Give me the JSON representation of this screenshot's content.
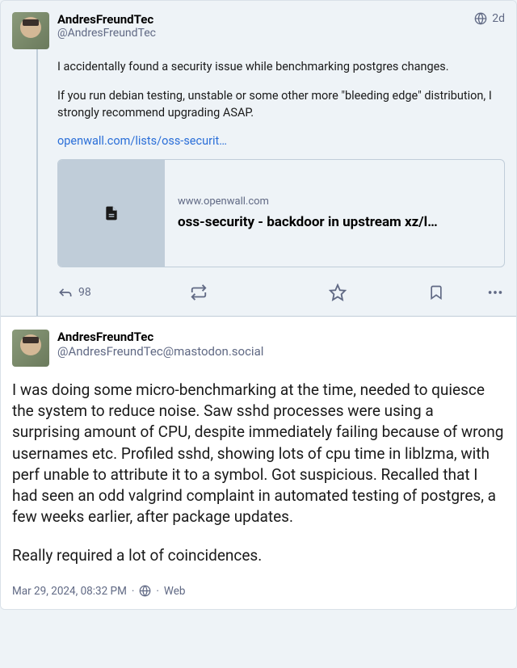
{
  "post1": {
    "display_name": "AndresFreundTec",
    "handle": "@AndresFreundTec",
    "age": "2d",
    "para1": "I accidentally found a security issue while benchmarking postgres changes.",
    "para2": "If you run debian testing, unstable or some other more \"bleeding edge\" distribution, I strongly recommend upgrading ASAP.",
    "link_text": "openwall.com/lists/oss-securit…",
    "link_card": {
      "domain": "www.openwall.com",
      "title": "oss-security - backdoor in upstream xz/l…"
    },
    "reply_count": "98"
  },
  "post2": {
    "display_name": "AndresFreundTec",
    "handle": "@AndresFreundTec@mastodon.social",
    "para1": "I was doing some micro-benchmarking at the time, needed to quiesce the system to reduce noise. Saw sshd processes were using a surprising amount of CPU, despite immediately failing because of wrong usernames etc. Profiled sshd, showing lots of cpu time in liblzma, with perf unable to attribute it to a symbol. Got suspicious. Recalled that I had seen an odd valgrind complaint in automated testing of postgres, a few weeks earlier, after  package updates.",
    "para2": "Really required a lot of coincidences.",
    "timestamp": "Mar 29, 2024, 08:32 PM",
    "source": "Web"
  }
}
